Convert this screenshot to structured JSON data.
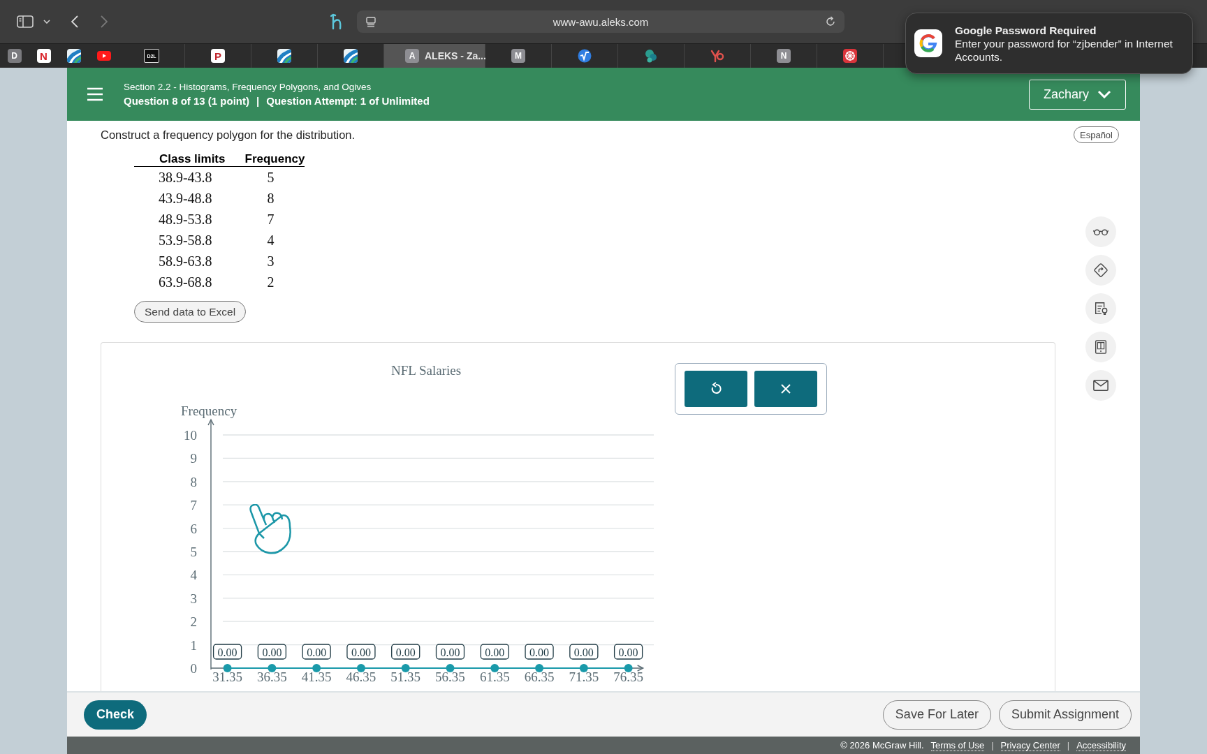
{
  "browser": {
    "address": "www-awu.aleks.com",
    "tabs": [
      {
        "kind": "badge",
        "letter": "D",
        "color": "#7a7a7e",
        "pinned": true,
        "selected": false
      },
      {
        "kind": "mark",
        "letter": "N",
        "color": "#d81f26",
        "pinned": true,
        "selected": false
      },
      {
        "kind": "stripes",
        "color": "#1f7fc4",
        "pinned": true,
        "selected": false
      },
      {
        "kind": "play",
        "color": "#ff1a1a",
        "pinned": true,
        "selected": false
      },
      {
        "kind": "badge",
        "letter": "D2L",
        "color": "#111111",
        "pinned": false,
        "selected": false
      },
      {
        "kind": "mark",
        "letter": "P",
        "color": "#c0262d",
        "pinned": false,
        "selected": false
      },
      {
        "kind": "stripes",
        "color": "#1f7fc4",
        "pinned": false,
        "selected": false
      },
      {
        "kind": "stripes",
        "color": "#1f7fc4",
        "pinned": false,
        "selected": false
      },
      {
        "kind": "badge",
        "letter": "A",
        "color": "#8e8e93",
        "pinned": false,
        "selected": true,
        "title": "ALEKS - Za..."
      },
      {
        "kind": "badge",
        "letter": "M",
        "color": "#8e8e93",
        "pinned": false,
        "selected": false
      },
      {
        "kind": "sqrt",
        "color": "#2f7de1",
        "pinned": false,
        "selected": false
      },
      {
        "kind": "blob",
        "color": "#2a9d8f",
        "pinned": false,
        "selected": false
      },
      {
        "kind": "yo",
        "color": "#e0524d",
        "pinned": false,
        "selected": false
      },
      {
        "kind": "badge",
        "letter": "N",
        "color": "#8e8e93",
        "pinned": false,
        "selected": false
      },
      {
        "kind": "flake",
        "color": "#d9343b",
        "pinned": false,
        "selected": false
      }
    ]
  },
  "notification": {
    "title": "Google Password Required",
    "message": "Enter your password for “zjbender” in Internet Accounts."
  },
  "header": {
    "section": "Section 2.2 - Histograms, Frequency Polygons, and Ogives",
    "question": "Question 8 of 13 (1 point)",
    "separator": "|",
    "attempt": "Question Attempt: 1 of Unlimited",
    "user": "Zachary"
  },
  "language_button": "Español",
  "prompt": "Construct a frequency polygon for the distribution.",
  "table": {
    "columns": [
      "Class limits",
      "Frequency"
    ],
    "rows": [
      [
        "38.9-43.8",
        "5"
      ],
      [
        "43.9-48.8",
        "8"
      ],
      [
        "48.9-53.8",
        "7"
      ],
      [
        "53.9-58.8",
        "4"
      ],
      [
        "58.9-63.8",
        "3"
      ],
      [
        "63.9-68.8",
        "2"
      ]
    ]
  },
  "excel_button": "Send data to Excel",
  "chart": {
    "chart_data": {
      "type": "line",
      "title": "NFL Salaries",
      "ylabel": "Frequency",
      "x": [
        31.35,
        36.35,
        41.35,
        46.35,
        51.35,
        56.35,
        61.35,
        66.35,
        71.35,
        76.35
      ],
      "series": [
        {
          "color": "#1a9aaa",
          "marker": "circle",
          "values": [
            0,
            0,
            0,
            0,
            0,
            0,
            0,
            0,
            0,
            0
          ]
        }
      ],
      "xlim": [
        29.5,
        78
      ],
      "grid": true,
      "value_labels": [
        "0.00",
        "0.00",
        "0.00",
        "0.00",
        "0.00",
        "0.00",
        "0.00",
        "0.00",
        "0.00",
        "0.00"
      ],
      "ylim": [
        0,
        10
      ],
      "yticks": [
        0,
        1,
        2,
        3,
        4,
        5,
        6,
        7,
        8,
        9,
        10
      ],
      "xticks": [
        31.35,
        36.35,
        41.35,
        46.35,
        51.35,
        56.35,
        61.35,
        66.35,
        71.35,
        76.35
      ]
    }
  },
  "footer": {
    "check": "Check",
    "save": "Save For Later",
    "submit": "Submit Assignment",
    "copyright": "© 2026 McGraw Hill.",
    "separator": "|",
    "links": [
      "Terms of Use",
      "Privacy Center",
      "Accessibility"
    ]
  }
}
